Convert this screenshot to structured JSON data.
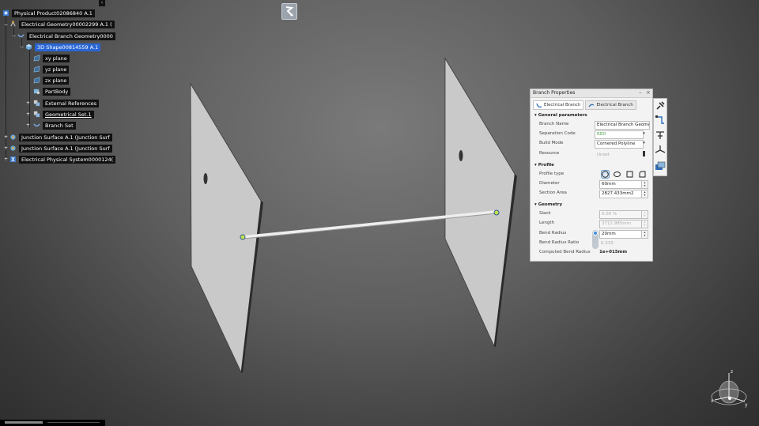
{
  "tree": {
    "close_label": "‹",
    "nodes": [
      {
        "label": "Physical Product02086840 A.1",
        "icon": "product-icon"
      },
      {
        "label": "Electrical Geometry00002299 A.1 (",
        "icon": "electrical-geometry-icon"
      },
      {
        "label": "Electrical Branch Geometry0000",
        "icon": "branch-geometry-icon"
      },
      {
        "label": "3D Shape00814559 A.1",
        "icon": "shape-icon"
      },
      {
        "label": "xy plane",
        "icon": "plane-icon"
      },
      {
        "label": "yz plane",
        "icon": "plane-icon"
      },
      {
        "label": "zx plane",
        "icon": "plane-icon"
      },
      {
        "label": "PartBody",
        "icon": "partbody-icon"
      },
      {
        "label": "External References",
        "icon": "references-icon"
      },
      {
        "label": "Geometrical Set.1",
        "icon": "geometrical-set-icon"
      },
      {
        "label": "Branch Set",
        "icon": "branch-set-icon"
      },
      {
        "label": "Junction Surface A.1 (Junction Surf",
        "icon": "junction-surface-icon"
      },
      {
        "label": "Junction Surface A.1 (Junction Surf",
        "icon": "junction-surface-icon"
      },
      {
        "label": "Electrical Physical System0000124(",
        "icon": "physical-system-icon"
      }
    ]
  },
  "panel": {
    "title": "Branch Properties",
    "tabs": [
      "Electrical Branch",
      "Electrical Branch"
    ],
    "general": {
      "heading": "General parameters",
      "branch_name_label": "Branch Name",
      "branch_name_value": "Electrical Branch Geome",
      "separation_code_label": "Separation Code",
      "separation_code_value": "RED",
      "build_mode_label": "Build Mode",
      "build_mode_value": "Cornered Polyline",
      "resource_label": "Resource",
      "resource_value": "Unset"
    },
    "profile": {
      "heading": "Profile",
      "profile_type_label": "Profile type",
      "diameter_label": "Diameter",
      "diameter_value": "60mm",
      "section_area_label": "Section Area",
      "section_area_value": "2827.433mm2"
    },
    "geometry": {
      "heading": "Geometry",
      "slack_label": "Slack",
      "slack_value": "0.00 %",
      "length_label": "Length",
      "length_value": "3712.985mm",
      "bend_radius_label": "Bend Radius",
      "bend_radius_value": "20mm",
      "bend_radius_ratio_label": "Bend Radius Ratio",
      "bend_radius_ratio_value": "0.333",
      "computed_bend_radius_label": "Computed Bend Radius",
      "computed_bend_radius_value": "1e+015mm"
    }
  },
  "compass": {
    "x": "x",
    "y": "y",
    "z": "z"
  },
  "colors": {
    "selection": "#2a66d4",
    "panel_bg": "#f3f3f3",
    "tree_label_bg": "#111111"
  }
}
